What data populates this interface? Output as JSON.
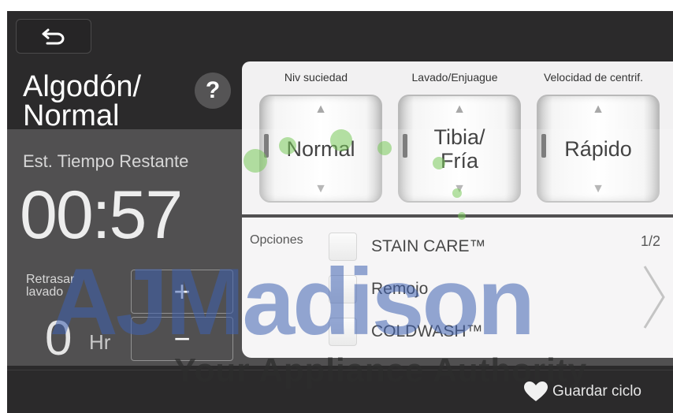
{
  "cycle": {
    "name": "Algodón/\nNormal",
    "help": "?"
  },
  "estimate": {
    "label": "Est. Tiempo Restante",
    "time": "00:57"
  },
  "delay": {
    "label": "Retrasar\nlavado",
    "value": "0",
    "unit": "Hr",
    "plus": "+",
    "minus": "−"
  },
  "settings": [
    {
      "label": "Niv suciedad",
      "value": "Normal"
    },
    {
      "label": "Lavado/Enjuague",
      "value": "Tibia/\nFría"
    },
    {
      "label": "Velocidad de centrif.",
      "value": "Rápido"
    }
  ],
  "options": {
    "title": "Opciones",
    "page": "1/2",
    "items": [
      {
        "label": "STAIN CARE™"
      },
      {
        "label": "Remojo"
      },
      {
        "label": "COLDWASH™"
      }
    ]
  },
  "footer": {
    "save_label": "Guardar ciclo"
  },
  "watermark": {
    "brand": "AJMadison",
    "tagline": "Your Appliance Authority"
  },
  "icons": {
    "back": "back-arrow-icon",
    "save": "heart-icon",
    "next": "chevron-right-icon"
  },
  "colors": {
    "background": "#2b2a2b",
    "panel": "#f2f1f2",
    "accent_green": "#78c85a",
    "watermark_blue": "#3e60b0"
  }
}
